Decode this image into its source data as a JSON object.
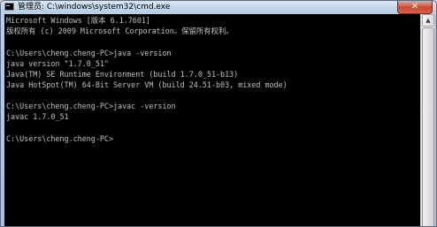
{
  "window": {
    "title": "管理员: C:\\windows\\system32\\cmd.exe",
    "icon": "cmd-icon",
    "close_glyph": "✕"
  },
  "console": {
    "text_color": "#c0c0c0",
    "background": "#000000",
    "lines": [
      "Microsoft Windows [版本 6.1.7601]",
      "版权所有 (c) 2009 Microsoft Corporation。保留所有权利。",
      "",
      "C:\\Users\\cheng.cheng-PC>java -version",
      "java version \"1.7.0_51\"",
      "Java(TM) SE Runtime Environment (build 1.7.0_51-b13)",
      "Java HotSpot(TM) 64-Bit Server VM (build 24.51-b03, mixed mode)",
      "",
      "C:\\Users\\cheng.cheng-PC>javac -version",
      "javac 1.7.0_51",
      "",
      "C:\\Users\\cheng.cheng-PC>"
    ]
  },
  "scrollbar": {
    "up_glyph": "▲"
  }
}
